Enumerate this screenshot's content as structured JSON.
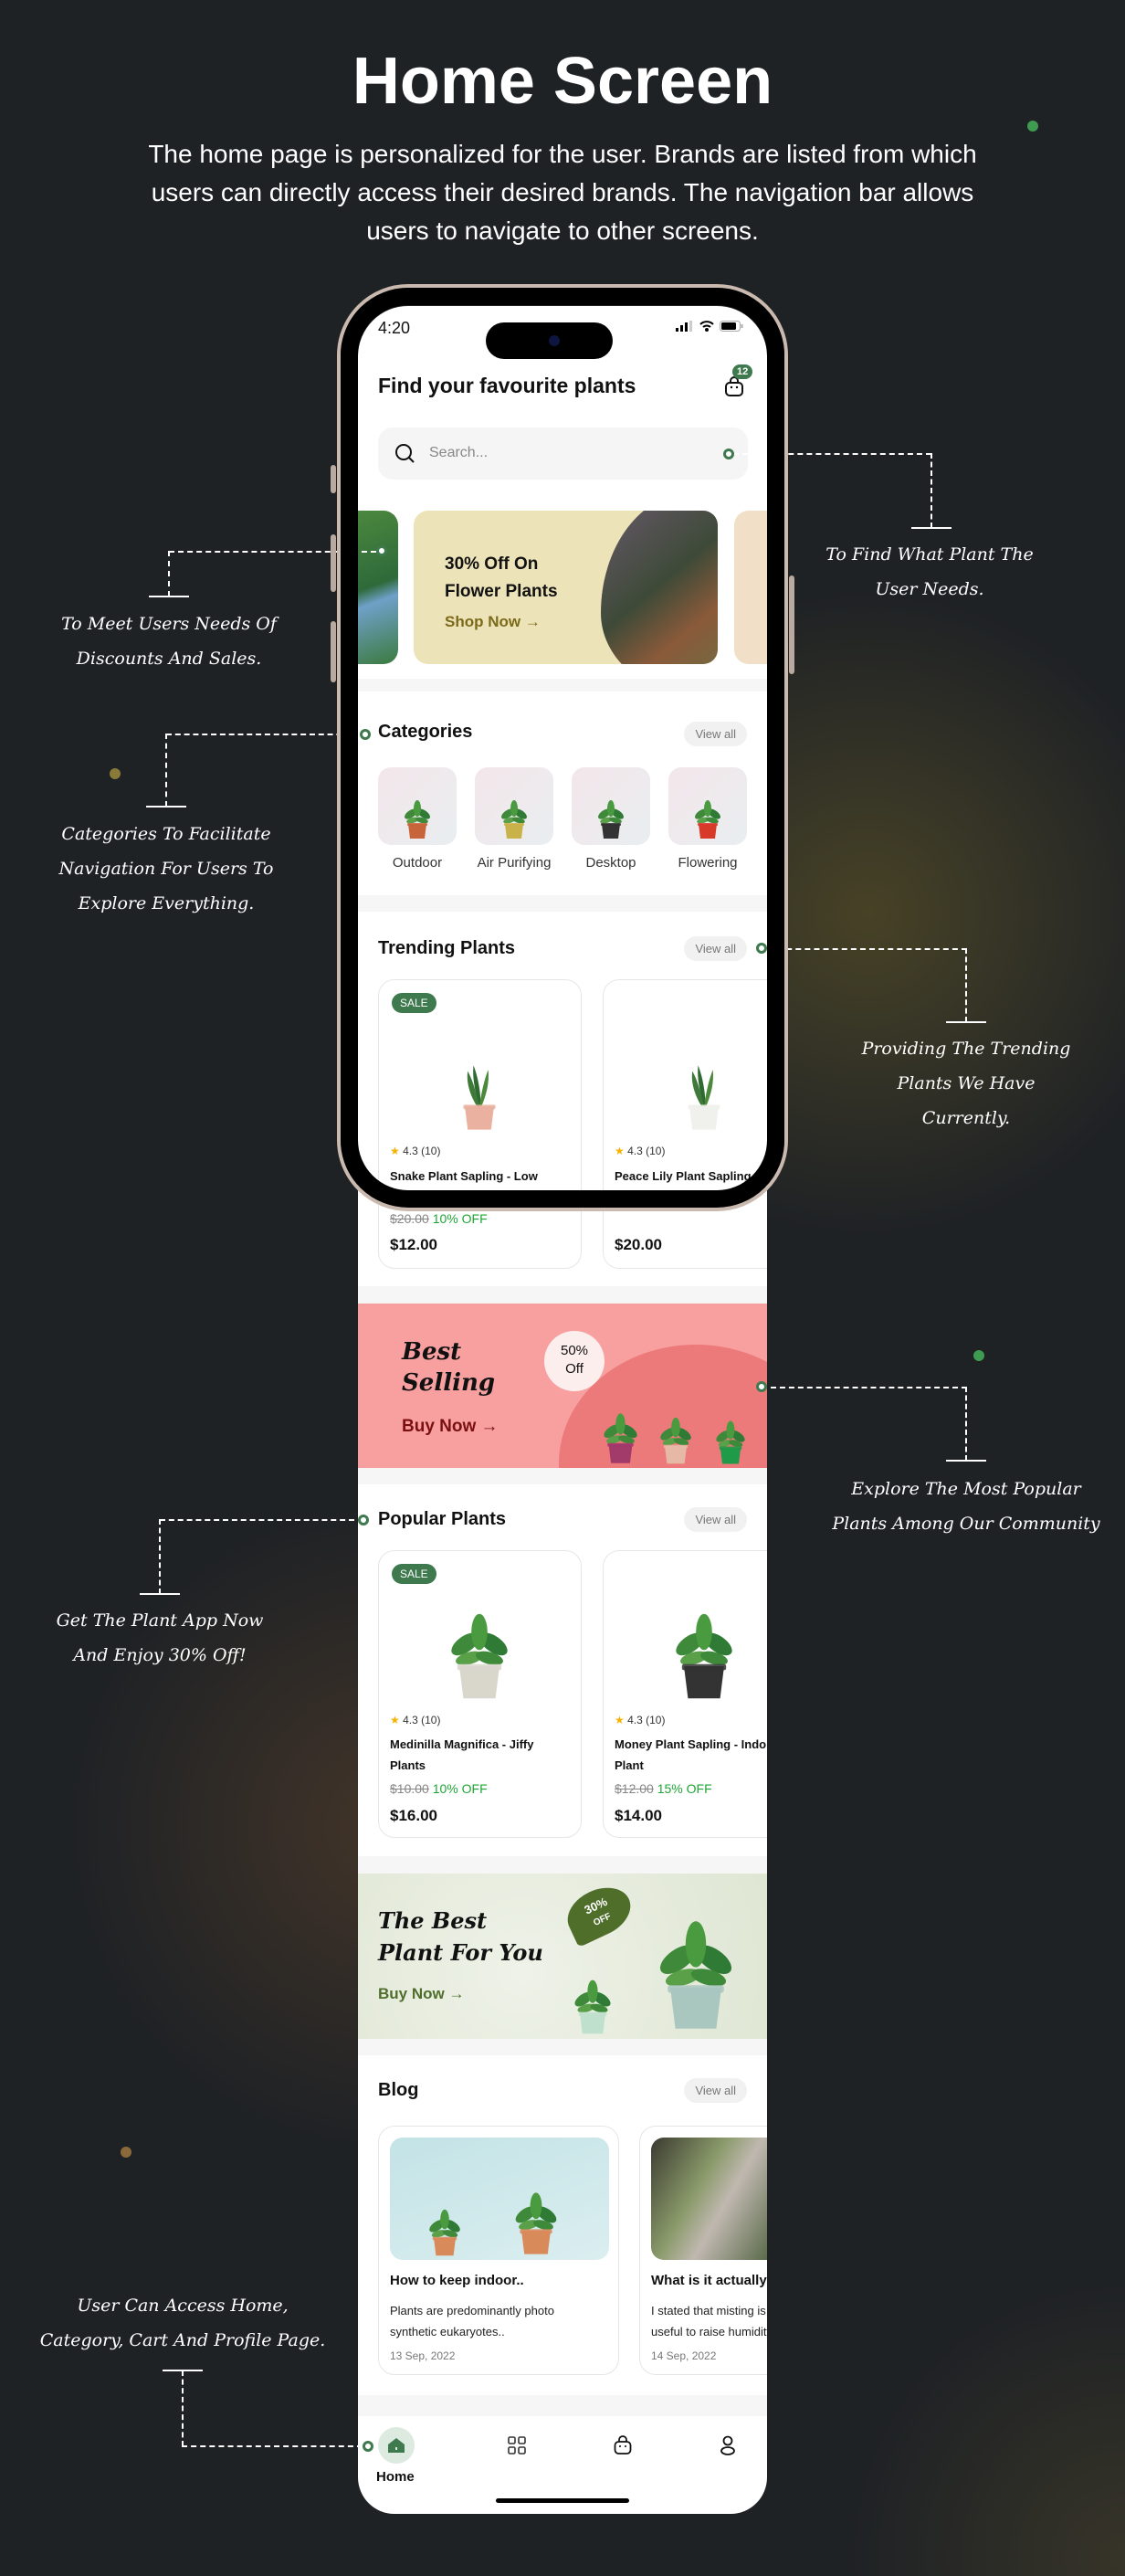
{
  "page": {
    "title": "Home Screen",
    "description": [
      "The home page is personalized for the user. Brands are listed from which",
      "users can directly access their desired brands. The navigation bar allows",
      "users to navigate to other screens."
    ]
  },
  "annotations": [
    {
      "lines": [
        "To Meet Users Needs Of",
        "Discounts And Sales."
      ]
    },
    {
      "lines": [
        "To Find What Plant The",
        "User Needs."
      ]
    },
    {
      "lines": [
        "Categories To Facilitate",
        "Navigation For Users To",
        "Explore Everything."
      ]
    },
    {
      "lines": [
        "Providing The Trending",
        "Plants We Have",
        "Currently."
      ]
    },
    {
      "lines": [
        "Explore The Most Popular",
        "Plants Among Our Community"
      ]
    },
    {
      "lines": [
        "Get The Plant App Now",
        "And Enjoy  30% Off!"
      ]
    },
    {
      "lines": [
        "User Can Access Home,",
        "Category, Cart And Profile Page."
      ]
    }
  ],
  "app": {
    "status_time": "4:20",
    "header_title": "Find your favourite plants",
    "cart_count": "12",
    "search_placeholder": "Search...",
    "promo_banner": {
      "line1": "30% Off On",
      "line2": "Flower Plants",
      "cta": "Shop Now →"
    },
    "categories": {
      "title": "Categories",
      "view_all": "View all",
      "items": [
        "Outdoor",
        "Air Purifying",
        "Desktop",
        "Flowering"
      ]
    },
    "trending": {
      "title": "Trending Plants",
      "view_all": "View all",
      "items": [
        {
          "sale": "SALE",
          "rating": "4.3",
          "reviews": "(10)",
          "name": "Snake Plant Sapling - Low",
          "old_price": "$20.00",
          "discount": "10% OFF",
          "price": "$12.00"
        },
        {
          "rating": "4.3",
          "reviews": "(10)",
          "name": "Peace Lily Plant Sapling",
          "price": "$20.00"
        }
      ]
    },
    "best_selling": {
      "line1": "Best",
      "line2": "Selling",
      "cta": "Buy Now →",
      "bubble1": "50%",
      "bubble2": "Off"
    },
    "popular": {
      "title": "Popular Plants",
      "view_all": "View all",
      "items": [
        {
          "sale": "SALE",
          "rating": "4.3",
          "reviews": "(10)",
          "name1": "Medinilla Magnifica - Jiffy",
          "name2": "Plants",
          "old_price": "$10.00",
          "discount": "10% OFF",
          "price": "$16.00"
        },
        {
          "rating": "4.3",
          "reviews": "(10)",
          "name1": "Money Plant Sapling - Indoor",
          "name2": "Plant",
          "old_price": "$12.00",
          "discount": "15% OFF",
          "price": "$14.00"
        }
      ]
    },
    "best_plant": {
      "line1": "The Best",
      "line2": "Plant For You",
      "cta": "Buy Now →",
      "tag1": "30%",
      "tag2": "OFF"
    },
    "blog": {
      "title": "Blog",
      "view_all": "View all",
      "items": [
        {
          "title": "How to keep indoor..",
          "line1": "Plants are predominantly photo",
          "line2": "synthetic eukaryotes..",
          "date": "13 Sep, 2022"
        },
        {
          "title": "What is it actually",
          "line1": " I stated that misting is",
          "line2": "useful to raise humidity",
          "date": "14 Sep, 2022"
        }
      ]
    },
    "nav": {
      "home_label": "Home",
      "items": [
        "home-icon",
        "category-grid-icon",
        "cart-bag-icon",
        "profile-icon"
      ]
    }
  },
  "colors": {
    "background": "#1f2225",
    "accent_green": "#3f7a4f",
    "discount_green": "#1fa636",
    "best_selling_bg": "#f8a0a0",
    "promo_bg": "#ede3b8",
    "best_plant_bg": "#e3e8d8"
  }
}
